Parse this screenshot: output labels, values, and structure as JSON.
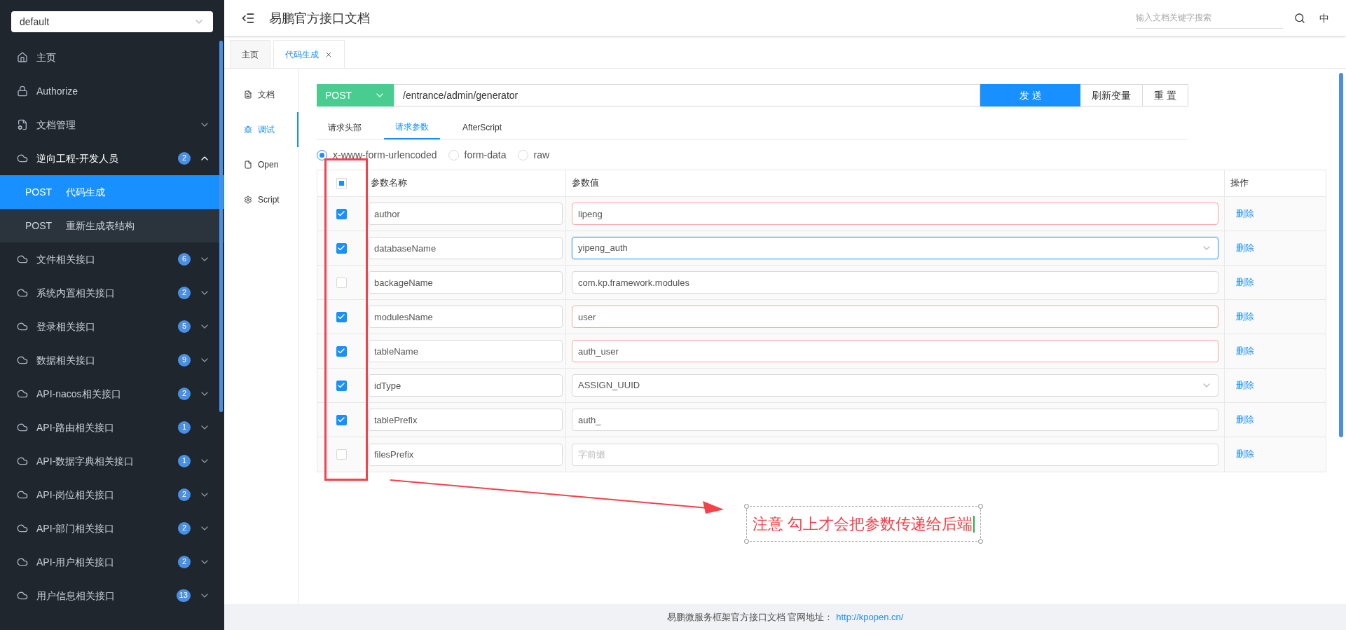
{
  "sidebar": {
    "project_select": {
      "value": "default"
    },
    "items": [
      {
        "kind": "home",
        "label": "主页"
      },
      {
        "kind": "lock",
        "label": "Authorize"
      },
      {
        "kind": "doc",
        "label": "文档管理",
        "expanded": false
      },
      {
        "kind": "group",
        "label": "逆向工程-开发人员",
        "count": "2",
        "expanded": true,
        "children": [
          {
            "method": "POST",
            "label": "代码生成",
            "selected": true
          },
          {
            "method": "POST",
            "label": "重新生成表结构",
            "selected": false
          }
        ]
      },
      {
        "kind": "group",
        "label": "文件相关接口",
        "count": "6",
        "expanded": false
      },
      {
        "kind": "group",
        "label": "系统内置相关接口",
        "count": "2",
        "expanded": false
      },
      {
        "kind": "group",
        "label": "登录相关接口",
        "count": "5",
        "expanded": false
      },
      {
        "kind": "group",
        "label": "数据相关接口",
        "count": "9",
        "expanded": false
      },
      {
        "kind": "group",
        "label": "API-nacos相关接口",
        "count": "2",
        "expanded": false
      },
      {
        "kind": "group",
        "label": "API-路由相关接口",
        "count": "1",
        "expanded": false
      },
      {
        "kind": "group",
        "label": "API-数据字典相关接口",
        "count": "1",
        "expanded": false
      },
      {
        "kind": "group",
        "label": "API-岗位相关接口",
        "count": "2",
        "expanded": false
      },
      {
        "kind": "group",
        "label": "API-部门相关接口",
        "count": "2",
        "expanded": false
      },
      {
        "kind": "group",
        "label": "API-用户相关接口",
        "count": "2",
        "expanded": false
      },
      {
        "kind": "group",
        "label": "用户信息相关接口",
        "count": "13",
        "expanded": false
      }
    ]
  },
  "header": {
    "title": "易鹏官方接口文档",
    "search": {
      "placeholder": "输入文档关键字搜索"
    },
    "language": "中"
  },
  "tabs": [
    {
      "label": "主页",
      "selected": false,
      "closable": false
    },
    {
      "label": "代码生成",
      "selected": true,
      "closable": true
    }
  ],
  "side_tabs": [
    {
      "kind": "doc",
      "label": "文档",
      "selected": false
    },
    {
      "kind": "debug",
      "label": "调试",
      "selected": true
    },
    {
      "kind": "open",
      "label": "Open",
      "selected": false
    },
    {
      "kind": "script",
      "label": "Script",
      "selected": false
    }
  ],
  "request": {
    "method": "POST",
    "url": "/entrance/admin/generator",
    "buttons": [
      {
        "kind": "primary",
        "label": "发 送"
      },
      {
        "kind": "default",
        "label": "刷新变量"
      },
      {
        "kind": "default",
        "label": "重 置"
      }
    ]
  },
  "request_tabs": [
    {
      "label": "请求头部",
      "selected": false
    },
    {
      "label": "请求参数",
      "selected": true
    },
    {
      "label": "AfterScript",
      "selected": false
    }
  ],
  "body_types": [
    {
      "label": "x-www-form-urlencoded",
      "selected": true
    },
    {
      "label": "form-data",
      "selected": false
    },
    {
      "label": "raw",
      "selected": false
    }
  ],
  "table": {
    "select_all": {
      "indeterminate": true
    },
    "columns": [
      "参数名称",
      "参数值",
      "操作"
    ],
    "rows": [
      {
        "checked": true,
        "name": "author",
        "kind": "input",
        "value": "lipeng",
        "required": true,
        "focused": false,
        "action": "删除"
      },
      {
        "checked": true,
        "name": "databaseName",
        "kind": "select",
        "value": "yipeng_auth",
        "required": false,
        "focused": true,
        "action": "删除"
      },
      {
        "checked": false,
        "name": "backageName",
        "kind": "input",
        "value": "com.kp.framework.modules",
        "required": false,
        "focused": false,
        "action": "删除"
      },
      {
        "checked": true,
        "name": "modulesName",
        "kind": "input",
        "value": "user",
        "required": true,
        "focused": false,
        "action": "删除"
      },
      {
        "checked": true,
        "name": "tableName",
        "kind": "input",
        "value": "auth_user",
        "required": true,
        "focused": false,
        "action": "删除"
      },
      {
        "checked": true,
        "name": "idType",
        "kind": "select",
        "value": "ASSIGN_UUID",
        "required": false,
        "focused": false,
        "action": "删除"
      },
      {
        "checked": true,
        "name": "tablePrefix",
        "kind": "input",
        "value": "auth_",
        "required": false,
        "focused": false,
        "action": "删除"
      },
      {
        "checked": false,
        "name": "filesPrefix",
        "kind": "input",
        "placeholder": "字前缀",
        "required": false,
        "focused": false,
        "action": "删除"
      }
    ]
  },
  "annotation": {
    "text": "注意 勾上才会把参数传递给后端"
  },
  "footer": {
    "text": "易鹏微服务框架官方接口文档 官网地址：",
    "link": "http://kpopen.cn/"
  }
}
